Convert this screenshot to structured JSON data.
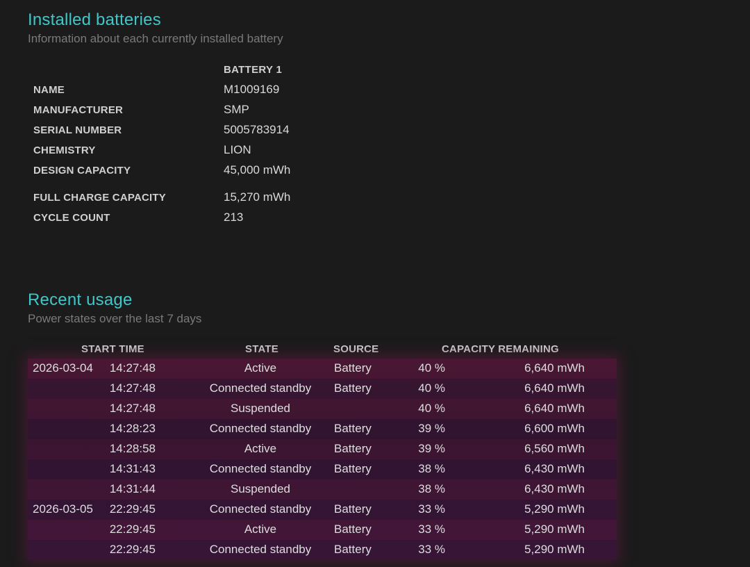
{
  "installed_batteries": {
    "title": "Installed batteries",
    "subtitle": "Information about each currently installed battery",
    "column_header": "BATTERY 1",
    "rows": [
      {
        "label": "NAME",
        "value": "M1009169"
      },
      {
        "label": "MANUFACTURER",
        "value": "SMP"
      },
      {
        "label": "SERIAL NUMBER",
        "value": "5005783914"
      },
      {
        "label": "CHEMISTRY",
        "value": "LION"
      },
      {
        "label": "DESIGN CAPACITY",
        "value": "45,000 mWh"
      },
      {
        "label": "FULL CHARGE CAPACITY",
        "value": "15,270 mWh"
      },
      {
        "label": "CYCLE COUNT",
        "value": "213"
      }
    ]
  },
  "recent_usage": {
    "title": "Recent usage",
    "subtitle": "Power states over the last 7 days",
    "columns": {
      "start_time": "START TIME",
      "state": "STATE",
      "source": "SOURCE",
      "capacity_remaining": "CAPACITY REMAINING"
    },
    "rows": [
      {
        "date": "2026-03-04",
        "time": "14:27:48",
        "state": "Active",
        "source": "Battery",
        "percent": "40 %",
        "capacity": "6,640 mWh"
      },
      {
        "date": "",
        "time": "14:27:48",
        "state": "Connected standby",
        "source": "Battery",
        "percent": "40 %",
        "capacity": "6,640 mWh"
      },
      {
        "date": "",
        "time": "14:27:48",
        "state": "Suspended",
        "source": "",
        "percent": "40 %",
        "capacity": "6,640 mWh"
      },
      {
        "date": "",
        "time": "14:28:23",
        "state": "Connected standby",
        "source": "Battery",
        "percent": "39 %",
        "capacity": "6,600 mWh"
      },
      {
        "date": "",
        "time": "14:28:58",
        "state": "Active",
        "source": "Battery",
        "percent": "39 %",
        "capacity": "6,560 mWh"
      },
      {
        "date": "",
        "time": "14:31:43",
        "state": "Connected standby",
        "source": "Battery",
        "percent": "38 %",
        "capacity": "6,430 mWh"
      },
      {
        "date": "",
        "time": "14:31:44",
        "state": "Suspended",
        "source": "",
        "percent": "38 %",
        "capacity": "6,430 mWh"
      },
      {
        "date": "2026-03-05",
        "time": "22:29:45",
        "state": "Connected standby",
        "source": "Battery",
        "percent": "33 %",
        "capacity": "5,290 mWh"
      },
      {
        "date": "",
        "time": "22:29:45",
        "state": "Active",
        "source": "Battery",
        "percent": "33 %",
        "capacity": "5,290 mWh"
      },
      {
        "date": "",
        "time": "22:29:45",
        "state": "Connected standby",
        "source": "Battery",
        "percent": "33 %",
        "capacity": "5,290 mWh"
      }
    ]
  }
}
